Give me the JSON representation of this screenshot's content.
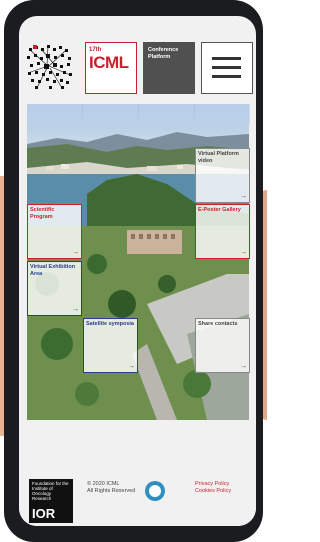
{
  "header": {
    "icml_small": "17th",
    "icml_big": "ICML",
    "conference_platform": "Conference Platform"
  },
  "tiles": {
    "virtual_platform_video": "Virtual Platform video",
    "scientific_program": "Scientific Program",
    "eposter_gallery": "E-Poster Gallery",
    "virtual_exhibition_area": "Virtual Exhibition Area",
    "satellite_symposia": "Satellite symposia",
    "share_contacts": "Share contacts",
    "arrow": "→"
  },
  "footer": {
    "foundation": "Foundation for the Institute of Oncology Research",
    "ior": "IOR",
    "copyright": "© 2020 ICML",
    "rights": "All Rights Reserved",
    "privacy": "Privacy Policy",
    "cookies": "Cookies Policy"
  },
  "colors": {
    "accent_red": "#cc1f2e",
    "accent_blue": "#2a3d8f",
    "phone_body": "#1b1c1f"
  }
}
